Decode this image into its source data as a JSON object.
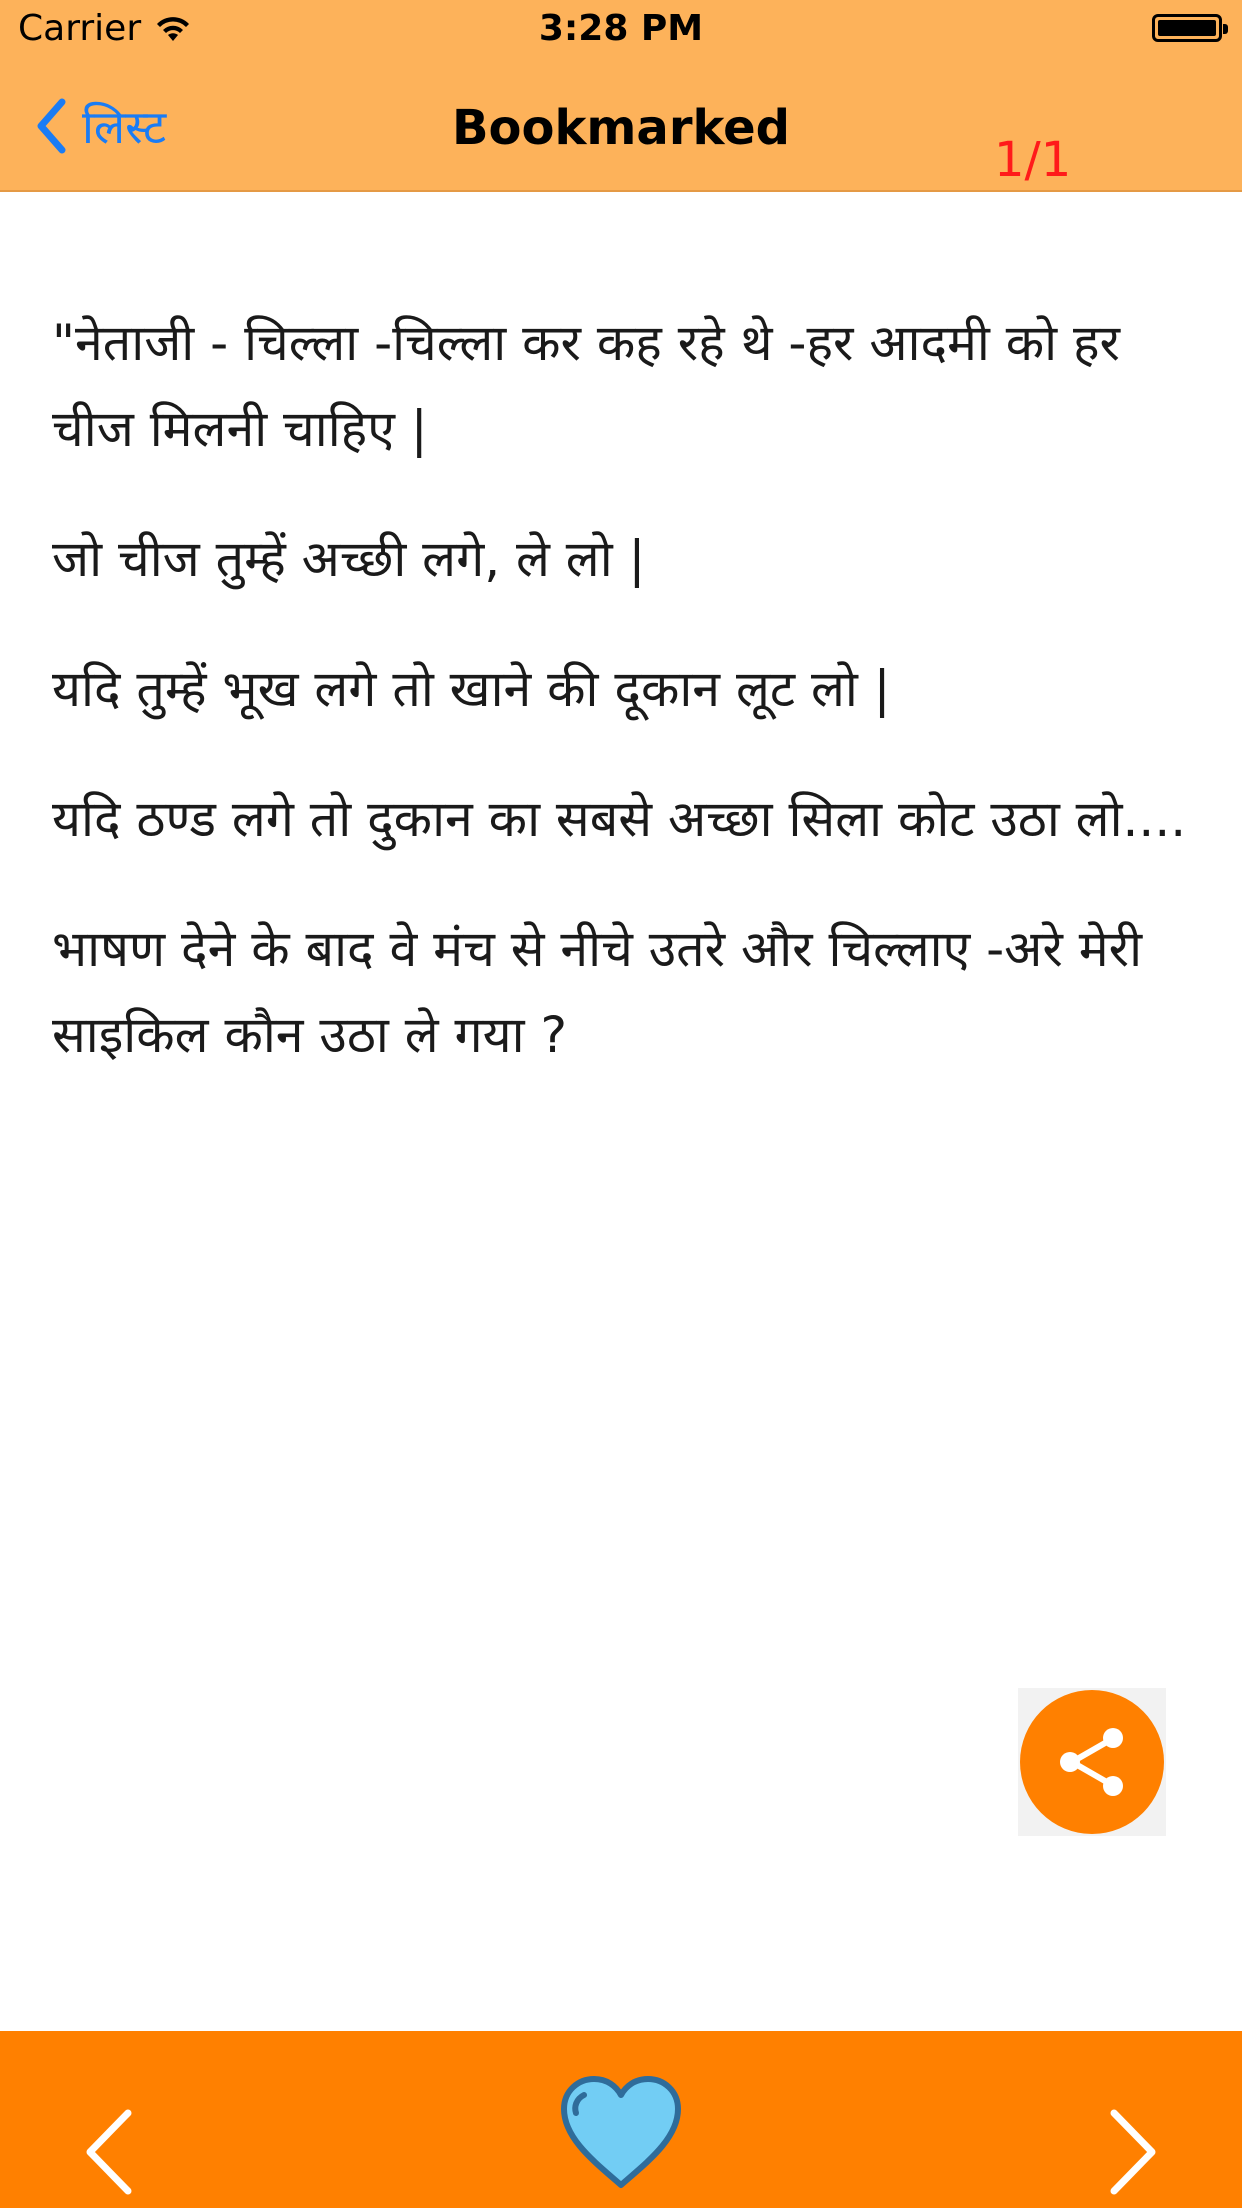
{
  "status_bar": {
    "carrier": "Carrier",
    "time": "3:28 PM"
  },
  "nav": {
    "back_label": "लिस्ट",
    "title": "Bookmarked",
    "page_counter": "1/1"
  },
  "content": {
    "paragraphs": [
      "\"नेताजी - चिल्ला -चिल्ला कर कह रहे थे -हर आदमी को हर चीज मिलनी चाहिए |",
      "जो चीज तुम्हें अच्छी लगे, ले लो |",
      "यदि तुम्हें भूख लगे तो खाने की दूकान लूट लो |",
      "यदि ठण्ड लगे तो दुकान का सबसे अच्छा सिला कोट उठा लो....",
      "भाषण देने के बाद वे मंच से नीचे उतरे और चिल्लाए -अरे मेरी साइकिल कौन उठा ले गया ?"
    ]
  },
  "icons": {
    "back": "chevron-left-icon",
    "share": "share-icon",
    "favorite": "heart-icon",
    "previous": "chevron-left-icon",
    "next": "chevron-right-icon"
  },
  "colors": {
    "nav_background": "#FDB25A",
    "toolbar_background": "#FF8000",
    "accent_blue": "#1A7CF5",
    "counter_red": "#FF1A1A",
    "heart_fill": "#72CDF4",
    "heart_stroke": "#2F6C9A"
  }
}
